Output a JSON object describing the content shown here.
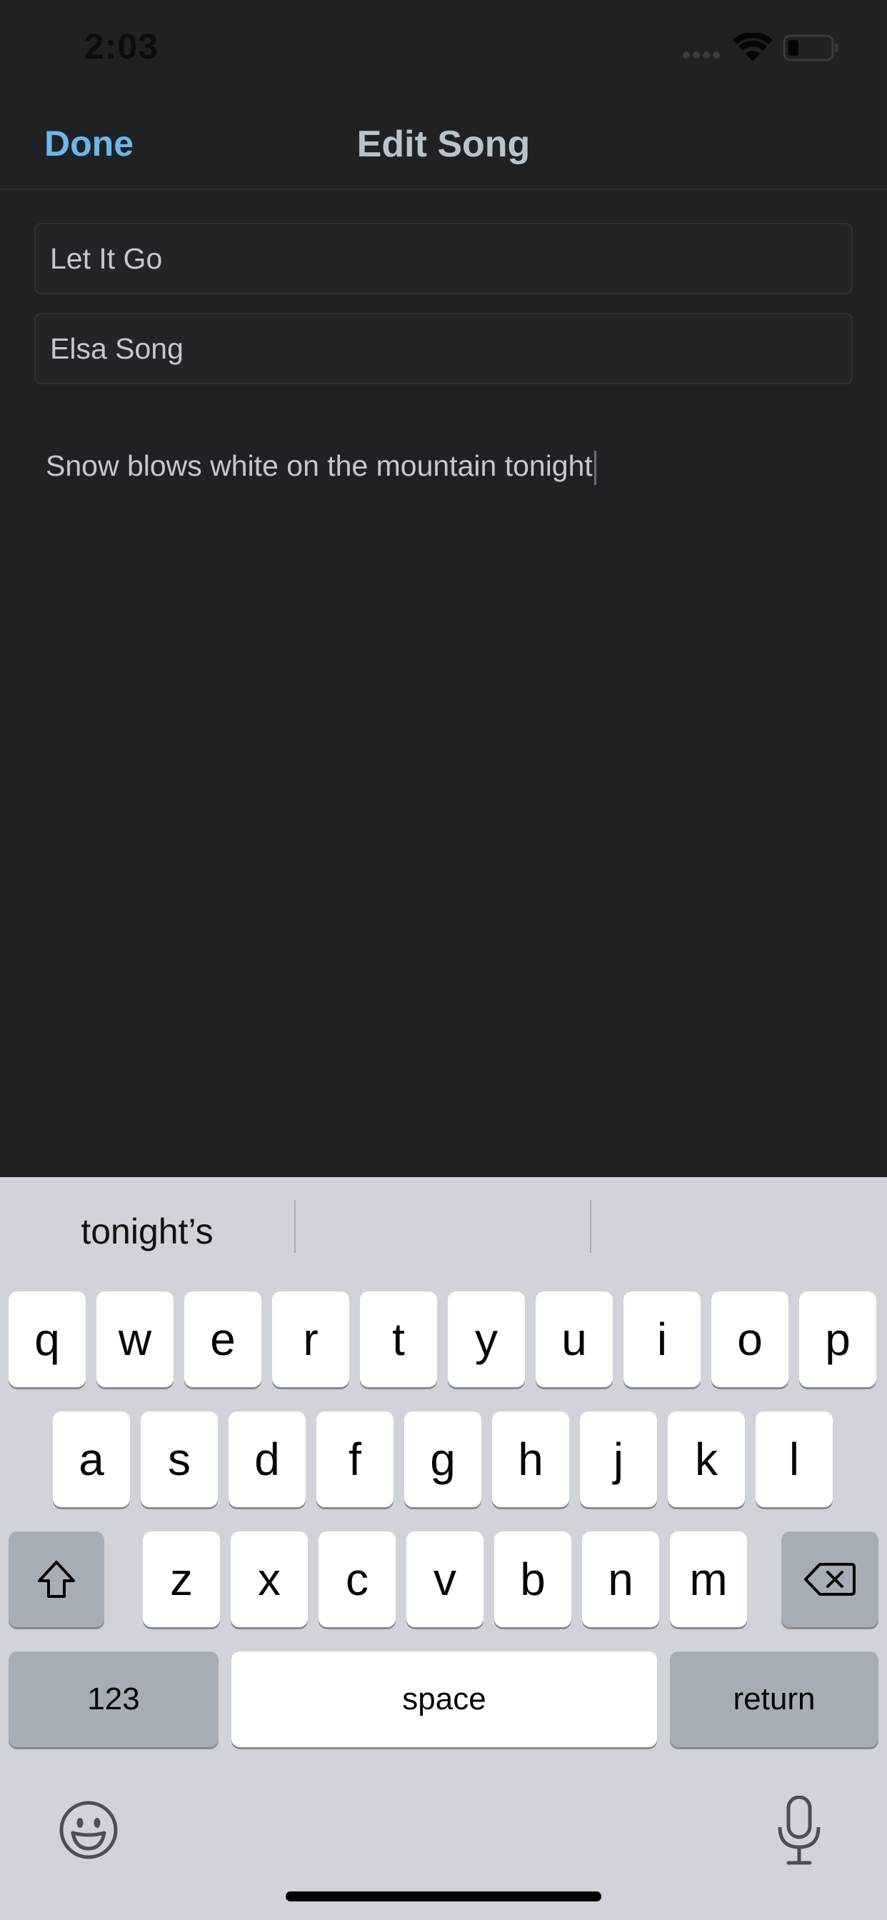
{
  "status_bar": {
    "time": "2:03"
  },
  "nav": {
    "done_label": "Done",
    "title": "Edit Song"
  },
  "form": {
    "title_value": "Let It Go",
    "artist_value": "Elsa Song",
    "lyrics_value": "Snow blows white on the mountain tonight"
  },
  "keyboard": {
    "suggestions": [
      "tonight’s",
      "",
      ""
    ],
    "row1": [
      "q",
      "w",
      "e",
      "r",
      "t",
      "y",
      "u",
      "i",
      "o",
      "p"
    ],
    "row2": [
      "a",
      "s",
      "d",
      "f",
      "g",
      "h",
      "j",
      "k",
      "l"
    ],
    "row3": [
      "z",
      "x",
      "c",
      "v",
      "b",
      "n",
      "m"
    ],
    "numbers_label": "123",
    "space_label": "space",
    "return_label": "return"
  },
  "icons": {
    "shift": "shift-icon",
    "backspace": "backspace-icon",
    "emoji": "emoji-icon",
    "mic": "microphone-icon",
    "wifi": "wifi-icon",
    "battery": "battery-icon"
  },
  "colors": {
    "accent": "#6ab8ec",
    "background": "#202124",
    "keyboard": "#d0d3da"
  }
}
